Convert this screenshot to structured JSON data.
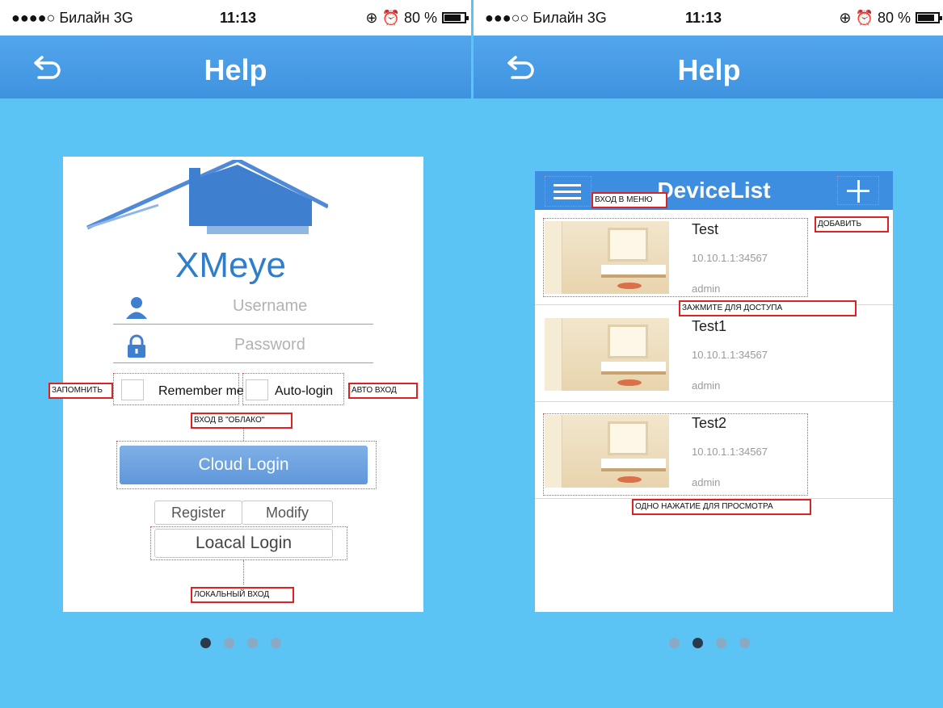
{
  "left_screen": {
    "status": {
      "carrier": "●●●●○ Билайн  3G",
      "time": "11:13",
      "battery": "80 %"
    },
    "nav": {
      "title": "Help"
    },
    "login": {
      "logo_text": "XMeye",
      "username_placeholder": "Username",
      "password_placeholder": "Password",
      "remember_label": "Remember me",
      "autologin_label": "Auto-login",
      "cloud_login_label": "Cloud Login",
      "register_label": "Register",
      "modify_label": "Modify",
      "local_login_label": "Loacal Login"
    },
    "notes": {
      "remember": "ЗАПОМНИТЬ",
      "autologin": "АВТО ВХОД",
      "cloud": "ВХОД В \"ОБЛАКО\"",
      "local": "ЛОКАЛЬНЫЙ ВХОД"
    },
    "page_indicator": {
      "total": 4,
      "active": 1
    }
  },
  "right_screen": {
    "status": {
      "carrier": "●●●○○ Билайн  3G",
      "time": "11:13",
      "battery": "80 %"
    },
    "nav": {
      "title": "Help"
    },
    "device_list": {
      "title": "DeviceList",
      "devices": [
        {
          "name": "Test",
          "address": "10.10.1.1:34567",
          "user": "admin"
        },
        {
          "name": "Test1",
          "address": "10.10.1.1:34567",
          "user": "admin"
        },
        {
          "name": "Test2",
          "address": "10.10.1.1:34567",
          "user": "admin"
        }
      ]
    },
    "notes": {
      "menu": "ВХОД В МЕНЮ",
      "add": "ДОБАВИТЬ",
      "hold": "ЗАЖМИТЕ ДЛЯ ДОСТУПА",
      "tap": "ОДНО НАЖАТИЕ ДЛЯ ПРОСМОТРА"
    },
    "page_indicator": {
      "total": 4,
      "active": 2
    }
  },
  "icons": [
    "back-arrow-icon",
    "user-icon",
    "lock-icon",
    "menu-icon",
    "plus-icon",
    "alarm-icon",
    "orientation-lock-icon",
    "battery-icon"
  ],
  "colors": {
    "background": "#5bc4f5",
    "nav_bar": "#3f92df",
    "cloud_button": "#6aa2de",
    "note_border": "#dd2222"
  }
}
